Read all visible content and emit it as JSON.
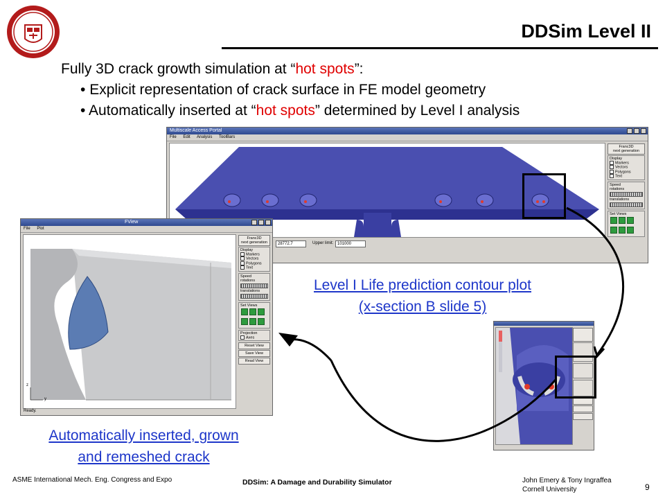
{
  "slide": {
    "title": "DDSim Level II",
    "intro": {
      "before": "Fully 3D crack growth simulation at “",
      "hot": "hot spots",
      "after": "”:"
    },
    "bullets": [
      {
        "bullet": "• ",
        "text": "Explicit representation of crack surface in FE model geometry"
      },
      {
        "bullet": "• ",
        "before": "Automatically inserted at “",
        "hot": "hot spots",
        "after": "” determined by Level I analysis"
      }
    ],
    "accent_color": "#e00000",
    "link_color": "#1d36c9"
  },
  "portal_window": {
    "title": "Multiscale Access Portal",
    "menu": [
      "File",
      "Edit",
      "Analysis",
      "ToolBars"
    ],
    "panel": {
      "logo_line1": "Franc3D",
      "logo_line2": "next generation",
      "display_label": "Display",
      "checks": [
        "Markers",
        "Vectors",
        "Polygons",
        "Text"
      ],
      "speed_label": "Speed",
      "rotations": "rotations",
      "translations": "translations",
      "set_views": "Set Views"
    },
    "lower_value": "28772.7",
    "upper_label": "Upper limit:",
    "upper_value": "101000"
  },
  "fview_window": {
    "title": "FView",
    "menu": [
      "File",
      "Plot"
    ],
    "panel": {
      "logo_line1": "Franc3D",
      "logo_line2": "next generation",
      "display_label": "Display",
      "checks": [
        "Markers",
        "Vectors",
        "Polygons",
        "Text"
      ],
      "speed_label": "Speed",
      "rotations": "rotations",
      "translations": "translations",
      "set_views": "Set Views",
      "projection": "Projection",
      "axes": "Axes",
      "reset_view": "Reset View",
      "save_view": "Save View",
      "read_view": "Read View"
    },
    "status": "Ready.",
    "axis_z": "z",
    "axis_y": "y"
  },
  "captions": {
    "level1_line1": "Level I Life prediction contour plot",
    "level1_line2": "(x-section B slide 5)",
    "crack_line1": "Automatically inserted, grown",
    "crack_line2": "and remeshed crack"
  },
  "footer": {
    "left": "ASME International Mech. Eng. Congress and Expo",
    "center": "DDSim: A Damage and Durability Simulator",
    "right_line1": "John Emery & Tony Ingraffea",
    "right_line2": "Cornell University",
    "page": "9"
  }
}
